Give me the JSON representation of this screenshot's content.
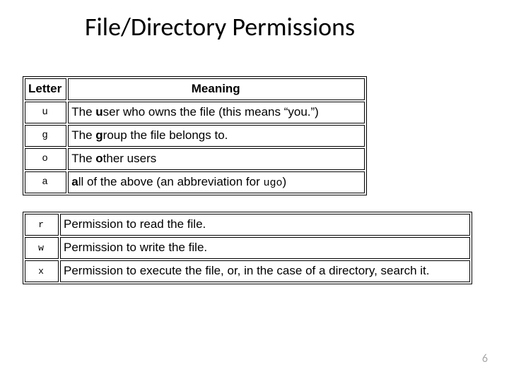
{
  "title": "File/Directory Permissions",
  "table1": {
    "headers": {
      "letter": "Letter",
      "meaning": "Meaning"
    },
    "rows": [
      {
        "letter": "u",
        "meaning_pre": "The ",
        "meaning_bold": "u",
        "meaning_post": "ser who owns the file (this means “you.”)"
      },
      {
        "letter": "g",
        "meaning_pre": "The ",
        "meaning_bold": "g",
        "meaning_post": "roup the file belongs to."
      },
      {
        "letter": "o",
        "meaning_pre": "The ",
        "meaning_bold": "o",
        "meaning_post": "ther users"
      },
      {
        "letter": "a",
        "meaning_pre": "",
        "meaning_bold": "a",
        "meaning_post": "ll of the above (an abbreviation for ",
        "meaning_mono": "ugo",
        "meaning_tail": ")"
      }
    ]
  },
  "table2": {
    "rows": [
      {
        "letter": "r",
        "meaning": "Permission to read the file."
      },
      {
        "letter": "w",
        "meaning": "Permission to write the file."
      },
      {
        "letter": "x",
        "meaning": "Permission to execute the file, or, in the case of a directory, search it."
      }
    ]
  },
  "page_number": "6"
}
